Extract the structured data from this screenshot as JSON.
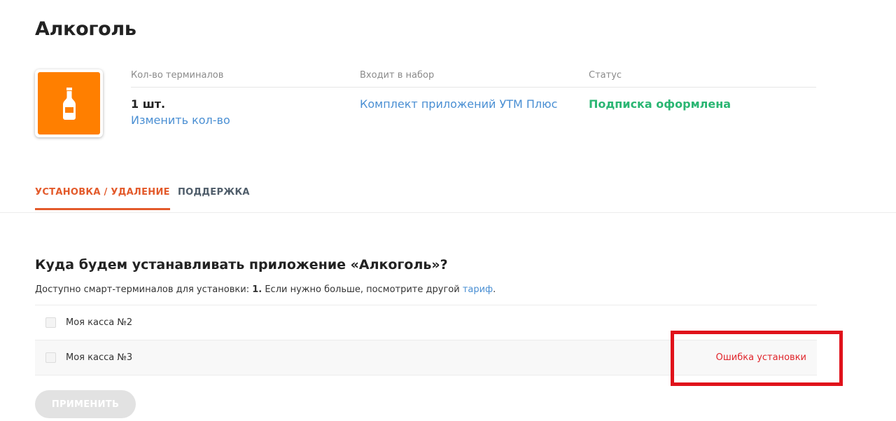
{
  "page": {
    "title": "Алкоголь"
  },
  "app": {
    "icon": "alcohol-bottle-icon",
    "icon_color": "#ff7f00"
  },
  "info": {
    "terminals": {
      "label": "Кол-во терминалов",
      "value": "1 шт.",
      "change_link": "Изменить кол-во"
    },
    "bundle": {
      "label": "Входит в набор",
      "value": "Комплект приложений УТМ Плюс"
    },
    "status": {
      "label": "Статус",
      "value": "Подписка оформлена",
      "color": "#2bb673"
    }
  },
  "tabs": [
    {
      "label": "УСТАНОВКА / УДАЛЕНИЕ",
      "active": true
    },
    {
      "label": "ПОДДЕРЖКА",
      "active": false
    }
  ],
  "install": {
    "title": "Куда будем устанавливать приложение «Алкоголь»?",
    "available_prefix": "Доступно смарт-терминалов для установки: ",
    "available_count": "1.",
    "available_suffix": " Если нужно больше, посмотрите другой ",
    "tariff_link": "тариф",
    "tariff_end": ".",
    "terminals": [
      {
        "name": "Моя касса №2",
        "status": ""
      },
      {
        "name": "Моя касса №3",
        "status": "Ошибка установки"
      }
    ],
    "apply_button": "ПРИМЕНИТЬ"
  },
  "colors": {
    "accent": "#e35a2b",
    "link": "#4a8fd3",
    "error": "#e0252b",
    "highlight": "#e0121b"
  }
}
